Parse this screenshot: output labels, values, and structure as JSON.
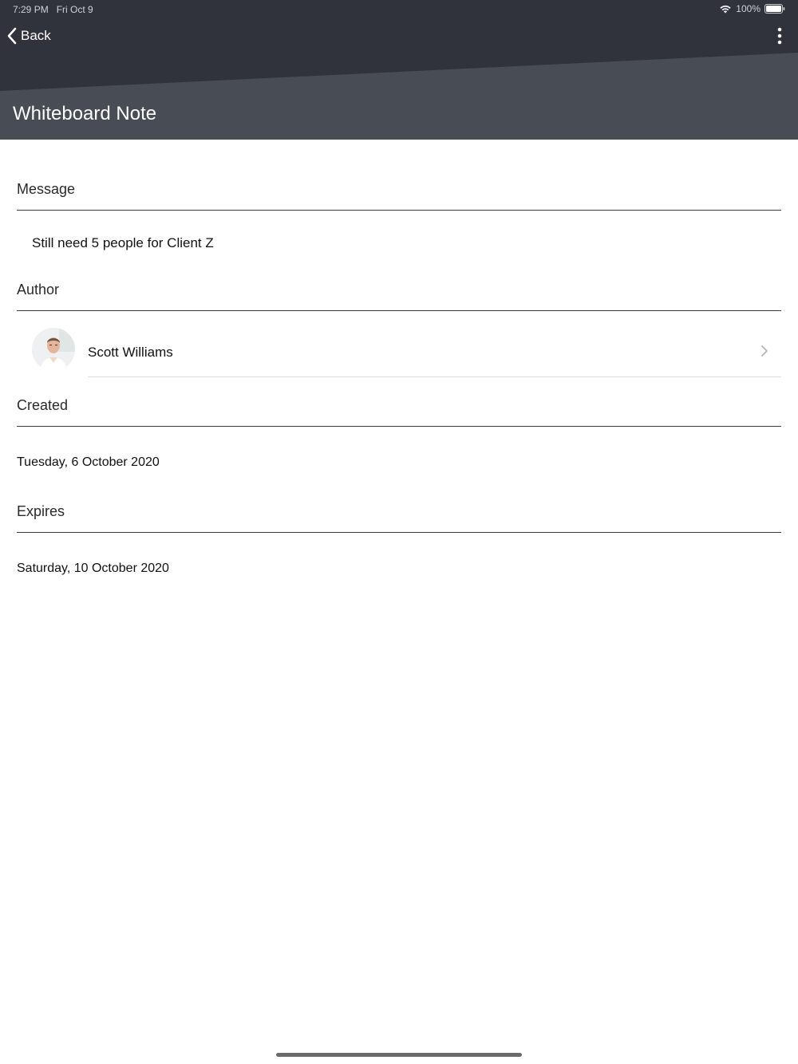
{
  "status_bar": {
    "time": "7:29 PM",
    "date": "Fri Oct 9",
    "battery": "100%",
    "icons": [
      "wifi-icon",
      "battery-icon"
    ]
  },
  "nav": {
    "back_label": "Back",
    "back_icon": "chevron-left-icon",
    "more_icon": "more-vertical-icon",
    "title": "Whiteboard Note"
  },
  "sections": {
    "message": {
      "label": "Message",
      "value": "Still need 5 people for Client Z"
    },
    "author": {
      "label": "Author",
      "name": "Scott Williams",
      "avatar_icon": "avatar-photo",
      "chevron_icon": "chevron-right-icon"
    },
    "created": {
      "label": "Created",
      "value": "Tuesday, 6 October 2020"
    },
    "expires": {
      "label": "Expires",
      "value": "Saturday, 10 October 2020"
    }
  },
  "colors": {
    "header_dark": "#30333b",
    "header_light": "#484c55",
    "divider": "#3a3a3a"
  }
}
